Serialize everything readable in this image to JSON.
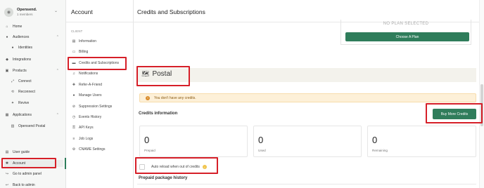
{
  "org": {
    "avatar_glyph": "◉",
    "name": "Opensend.",
    "members": "1 members"
  },
  "nav": {
    "home": "Home",
    "audiences": "Audiences",
    "identities": "Identities",
    "integrations": "Integrations",
    "products": "Products",
    "connect": "Connect",
    "reconnect": "Reconnect",
    "revive": "Revive",
    "applications": "Applications",
    "opensend_postal": "Opensend Postal",
    "user_guide": "User guide",
    "account": "Account",
    "go_admin": "Go to admin panel",
    "back_admin": "Back to admin"
  },
  "account_panel": {
    "title": "Account",
    "section": "CLIENT",
    "items": [
      "Information",
      "Billing",
      "Credits and Subscriptions",
      "Notifications",
      "Refer-A-Friend",
      "Manage Users",
      "Suppression Settings",
      "Events History",
      "API Keys",
      "Job Logs",
      "CNAME Settings"
    ]
  },
  "main": {
    "title": "Credits and Subscriptions",
    "plan_status": "NO PLAN SELECTED",
    "choose_plan": "Choose A Plan",
    "product": "Postal",
    "alert": "You don't have any credits.",
    "credits_info": "Credits information",
    "buy_more": "Buy More Credits",
    "stats": [
      {
        "value": "0",
        "label": "Prepaid"
      },
      {
        "value": "0",
        "label": "Used"
      },
      {
        "value": "0",
        "label": "Remaining"
      }
    ],
    "auto_reload": "Auto reload when out of credits",
    "prepaid_history": "Prepaid package history"
  },
  "colors": {
    "accent": "#2f7d5b",
    "highlight": "#d61f28",
    "alert_bg": "#fdf0d8",
    "postal_bar": "#f3f2ec"
  }
}
